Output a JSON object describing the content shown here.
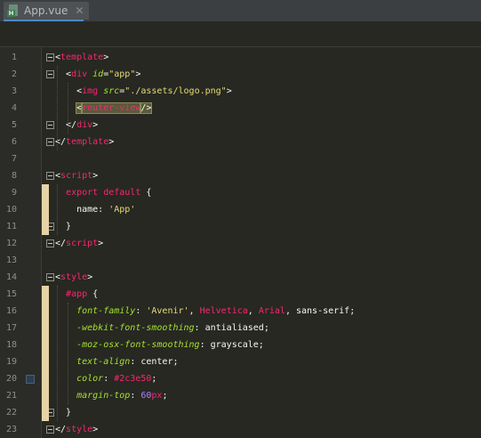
{
  "tab": {
    "title": "App.vue",
    "close": "✕",
    "icon_badge": "H"
  },
  "lines": [
    {
      "n": "1",
      "tokens": [
        {
          "t": "<",
          "c": "plain"
        },
        {
          "t": "template",
          "c": "tag"
        },
        {
          "t": ">",
          "c": "plain"
        }
      ]
    },
    {
      "n": "2",
      "tokens": [
        {
          "t": "  <",
          "c": "plain"
        },
        {
          "t": "div",
          "c": "tag"
        },
        {
          "t": " ",
          "c": "plain"
        },
        {
          "t": "id",
          "c": "attr"
        },
        {
          "t": "=",
          "c": "plain"
        },
        {
          "t": "\"app\"",
          "c": "str"
        },
        {
          "t": ">",
          "c": "plain"
        }
      ]
    },
    {
      "n": "3",
      "tokens": [
        {
          "t": "    <",
          "c": "plain"
        },
        {
          "t": "img",
          "c": "tag"
        },
        {
          "t": " ",
          "c": "plain"
        },
        {
          "t": "src",
          "c": "attr"
        },
        {
          "t": "=",
          "c": "plain"
        },
        {
          "t": "\"./assets/logo.png\"",
          "c": "str"
        },
        {
          "t": ">",
          "c": "plain"
        }
      ]
    },
    {
      "n": "4",
      "tokens": [
        {
          "t": "    ",
          "c": "plain"
        },
        {
          "t": "<",
          "c": "plain hl"
        },
        {
          "t": "router-view",
          "c": "tag hl"
        },
        {
          "t": "/>",
          "c": "plain hl"
        }
      ]
    },
    {
      "n": "5",
      "tokens": [
        {
          "t": "  </",
          "c": "plain"
        },
        {
          "t": "div",
          "c": "tag"
        },
        {
          "t": ">",
          "c": "plain"
        }
      ]
    },
    {
      "n": "6",
      "tokens": [
        {
          "t": "</",
          "c": "plain"
        },
        {
          "t": "template",
          "c": "tag"
        },
        {
          "t": ">",
          "c": "plain"
        }
      ]
    },
    {
      "n": "7",
      "tokens": []
    },
    {
      "n": "8",
      "tokens": [
        {
          "t": "<",
          "c": "plain"
        },
        {
          "t": "script",
          "c": "tag"
        },
        {
          "t": ">",
          "c": "plain"
        }
      ]
    },
    {
      "n": "9",
      "tokens": [
        {
          "t": "  ",
          "c": "plain"
        },
        {
          "t": "export default",
          "c": "kw"
        },
        {
          "t": " {",
          "c": "plain"
        }
      ]
    },
    {
      "n": "10",
      "tokens": [
        {
          "t": "    name",
          "c": "plain"
        },
        {
          "t": ": ",
          "c": "plain"
        },
        {
          "t": "'App'",
          "c": "str"
        }
      ]
    },
    {
      "n": "11",
      "tokens": [
        {
          "t": "  }",
          "c": "plain"
        }
      ]
    },
    {
      "n": "12",
      "tokens": [
        {
          "t": "</",
          "c": "plain"
        },
        {
          "t": "script",
          "c": "tag"
        },
        {
          "t": ">",
          "c": "plain"
        }
      ]
    },
    {
      "n": "13",
      "tokens": []
    },
    {
      "n": "14",
      "tokens": [
        {
          "t": "<",
          "c": "plain"
        },
        {
          "t": "style",
          "c": "tag"
        },
        {
          "t": ">",
          "c": "plain"
        }
      ]
    },
    {
      "n": "15",
      "tokens": [
        {
          "t": "  ",
          "c": "plain"
        },
        {
          "t": "#app",
          "c": "sel"
        },
        {
          "t": " {",
          "c": "plain"
        }
      ]
    },
    {
      "n": "16",
      "tokens": [
        {
          "t": "    ",
          "c": "plain"
        },
        {
          "t": "font-family",
          "c": "prop"
        },
        {
          "t": ": ",
          "c": "plain"
        },
        {
          "t": "'Avenir'",
          "c": "str"
        },
        {
          "t": ", ",
          "c": "plain"
        },
        {
          "t": "Helvetica",
          "c": "kw"
        },
        {
          "t": ", ",
          "c": "plain"
        },
        {
          "t": "Arial",
          "c": "kw"
        },
        {
          "t": ", ",
          "c": "plain"
        },
        {
          "t": "sans-serif",
          "c": "plain"
        },
        {
          "t": ";",
          "c": "plain"
        }
      ]
    },
    {
      "n": "17",
      "tokens": [
        {
          "t": "    ",
          "c": "plain"
        },
        {
          "t": "-webkit-font-smoothing",
          "c": "prop"
        },
        {
          "t": ": antialiased;",
          "c": "plain"
        }
      ]
    },
    {
      "n": "18",
      "tokens": [
        {
          "t": "    ",
          "c": "plain"
        },
        {
          "t": "-moz-osx-font-smoothing",
          "c": "prop"
        },
        {
          "t": ": grayscale;",
          "c": "plain"
        }
      ]
    },
    {
      "n": "19",
      "tokens": [
        {
          "t": "    ",
          "c": "plain"
        },
        {
          "t": "text-align",
          "c": "prop"
        },
        {
          "t": ": center;",
          "c": "plain"
        }
      ]
    },
    {
      "n": "20",
      "tokens": [
        {
          "t": "    ",
          "c": "plain"
        },
        {
          "t": "color",
          "c": "prop"
        },
        {
          "t": ": ",
          "c": "plain"
        },
        {
          "t": "#2c3e50",
          "c": "kw"
        },
        {
          "t": ";",
          "c": "plain"
        }
      ]
    },
    {
      "n": "21",
      "tokens": [
        {
          "t": "    ",
          "c": "plain"
        },
        {
          "t": "margin-top",
          "c": "prop"
        },
        {
          "t": ": ",
          "c": "plain"
        },
        {
          "t": "60",
          "c": "num"
        },
        {
          "t": "px",
          "c": "kw"
        },
        {
          "t": ";",
          "c": "plain"
        }
      ]
    },
    {
      "n": "22",
      "tokens": [
        {
          "t": "  }",
          "c": "plain"
        }
      ]
    },
    {
      "n": "23",
      "tokens": [
        {
          "t": "</",
          "c": "plain"
        },
        {
          "t": "style",
          "c": "tag"
        },
        {
          "t": ">",
          "c": "plain"
        }
      ]
    }
  ],
  "colors": {
    "background": "#272822",
    "tag": "#f92672",
    "attribute": "#a6e22e",
    "string": "#e6db74",
    "number": "#ae81ff",
    "swatch": "#2c3e50",
    "scope_bar": "#e6d3a6"
  }
}
